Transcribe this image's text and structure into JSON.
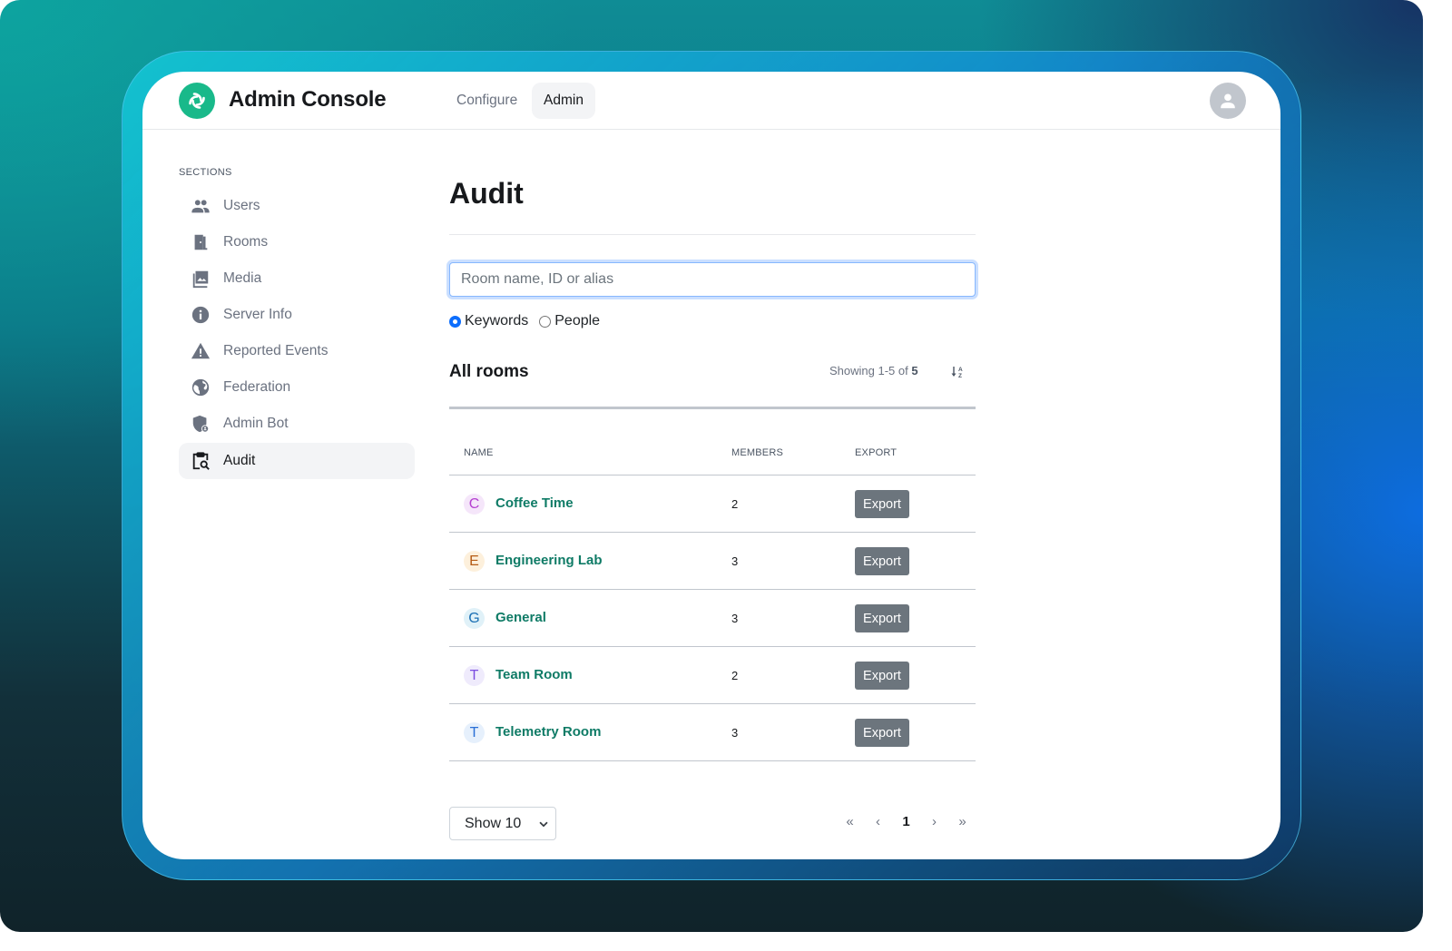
{
  "header": {
    "app_title": "Admin Console",
    "nav": [
      {
        "label": "Configure",
        "active": false
      },
      {
        "label": "Admin",
        "active": true
      }
    ]
  },
  "sidebar": {
    "section_label": "SECTIONS",
    "items": [
      {
        "label": "Users",
        "icon": "users-icon",
        "active": false
      },
      {
        "label": "Rooms",
        "icon": "door-icon",
        "active": false
      },
      {
        "label": "Media",
        "icon": "image-icon",
        "active": false
      },
      {
        "label": "Server Info",
        "icon": "info-icon",
        "active": false
      },
      {
        "label": "Reported Events",
        "icon": "warning-icon",
        "active": false
      },
      {
        "label": "Federation",
        "icon": "globe-icon",
        "active": false
      },
      {
        "label": "Admin Bot",
        "icon": "shield-user-icon",
        "active": false
      },
      {
        "label": "Audit",
        "icon": "clipboard-search-icon",
        "active": true
      }
    ]
  },
  "main": {
    "title": "Audit",
    "search": {
      "placeholder": "Room name, ID or alias",
      "value": ""
    },
    "search_mode": {
      "options": [
        {
          "label": "Keywords",
          "checked": true
        },
        {
          "label": "People",
          "checked": false
        }
      ]
    },
    "rooms": {
      "title": "All rooms",
      "showing_prefix": "Showing 1-5 of",
      "showing_total": "5",
      "sort_icon": "sort-alpha-icon",
      "columns": [
        "NAME",
        "MEMBERS",
        "EXPORT"
      ],
      "rows": [
        {
          "initial": "C",
          "name": "Coffee Time",
          "members": "2",
          "export_label": "Export",
          "avatar_bg": "#f5e6fa",
          "avatar_fg": "#b43fd0"
        },
        {
          "initial": "E",
          "name": "Engineering Lab",
          "members": "3",
          "export_label": "Export",
          "avatar_bg": "#fdf0dc",
          "avatar_fg": "#b45a14"
        },
        {
          "initial": "G",
          "name": "General",
          "members": "3",
          "export_label": "Export",
          "avatar_bg": "#e0f1f8",
          "avatar_fg": "#1a6fb4"
        },
        {
          "initial": "T",
          "name": "Team Room",
          "members": "2",
          "export_label": "Export",
          "avatar_bg": "#efebfc",
          "avatar_fg": "#7c4de0"
        },
        {
          "initial": "T",
          "name": "Telemetry Room",
          "members": "3",
          "export_label": "Export",
          "avatar_bg": "#e6f0fc",
          "avatar_fg": "#2a6fd6"
        }
      ]
    },
    "page_size": {
      "selected": "Show 10"
    },
    "pagination": {
      "first": "«",
      "prev": "‹",
      "current": "1",
      "next": "›",
      "last": "»"
    }
  },
  "colors": {
    "brand": "#19b98a",
    "link": "#0f7b66",
    "export_button": "#6c757d",
    "focus": "#86b7fe"
  }
}
